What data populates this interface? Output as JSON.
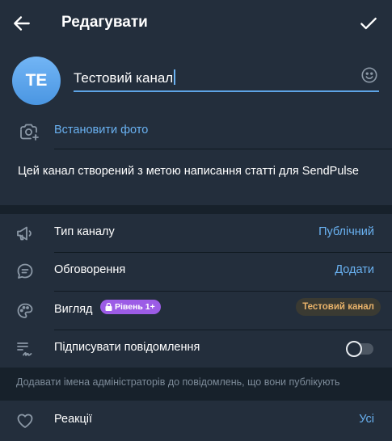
{
  "header": {
    "title": "Редагувати"
  },
  "channel": {
    "avatar_initials": "TE",
    "name_value": "Тестовий канал",
    "set_photo_label": "Встановити фото",
    "description": "Цей канал створений з метою написання статті для SendPulse"
  },
  "settings": {
    "channel_type": {
      "label": "Тип каналу",
      "value": "Публічний"
    },
    "discussion": {
      "label": "Обговорення",
      "value": "Додати"
    },
    "appearance": {
      "label": "Вигляд",
      "badge": "Рівень 1+",
      "value": "Тестовий канал"
    },
    "sign_messages": {
      "label": "Підписувати повідомлення",
      "enabled": false
    },
    "sign_hint": "Додавати імена адміністраторів до повідомлень, що вони публікують",
    "reactions": {
      "label": "Реакції",
      "value": "Усі"
    }
  },
  "colors": {
    "background": "#17212b",
    "card": "#232e3c",
    "accent": "#6ab2f2",
    "badge": "#9c5ce6",
    "pill_text": "#e9b36a"
  },
  "icons": {
    "back": "arrow-left-icon",
    "confirm": "check-icon",
    "emoji": "smile-icon",
    "photo": "camera-add-icon",
    "channel_type": "megaphone-icon",
    "discussion": "chat-bubble-icon",
    "appearance": "palette-icon",
    "sign": "signature-icon",
    "lock": "lock-icon",
    "reactions": "heart-icon"
  }
}
